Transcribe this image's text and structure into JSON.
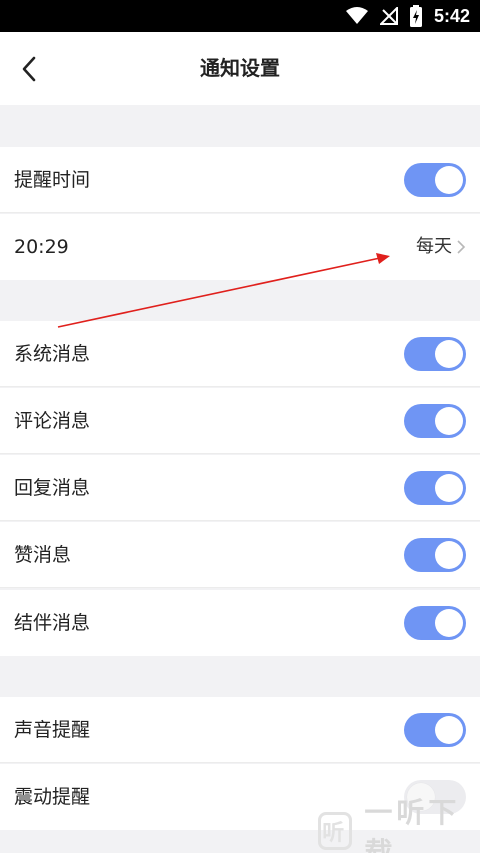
{
  "status_bar": {
    "time": "5:42"
  },
  "header": {
    "title": "通知设置"
  },
  "reminder": {
    "label": "提醒时间",
    "enabled": true,
    "time": "20:29",
    "repeat": "每天"
  },
  "messages": [
    {
      "label": "系统消息",
      "enabled": true
    },
    {
      "label": "评论消息",
      "enabled": true
    },
    {
      "label": "回复消息",
      "enabled": true
    },
    {
      "label": "赞消息",
      "enabled": true
    },
    {
      "label": "结伴消息",
      "enabled": true
    }
  ],
  "alerts": [
    {
      "label": "声音提醒",
      "enabled": true
    },
    {
      "label": "震动提醒",
      "enabled": false
    }
  ],
  "watermark": {
    "text": "一听下载",
    "logo": "听"
  },
  "colors": {
    "toggle_on": "#6f95f4",
    "annotation_arrow": "#e0201c"
  }
}
